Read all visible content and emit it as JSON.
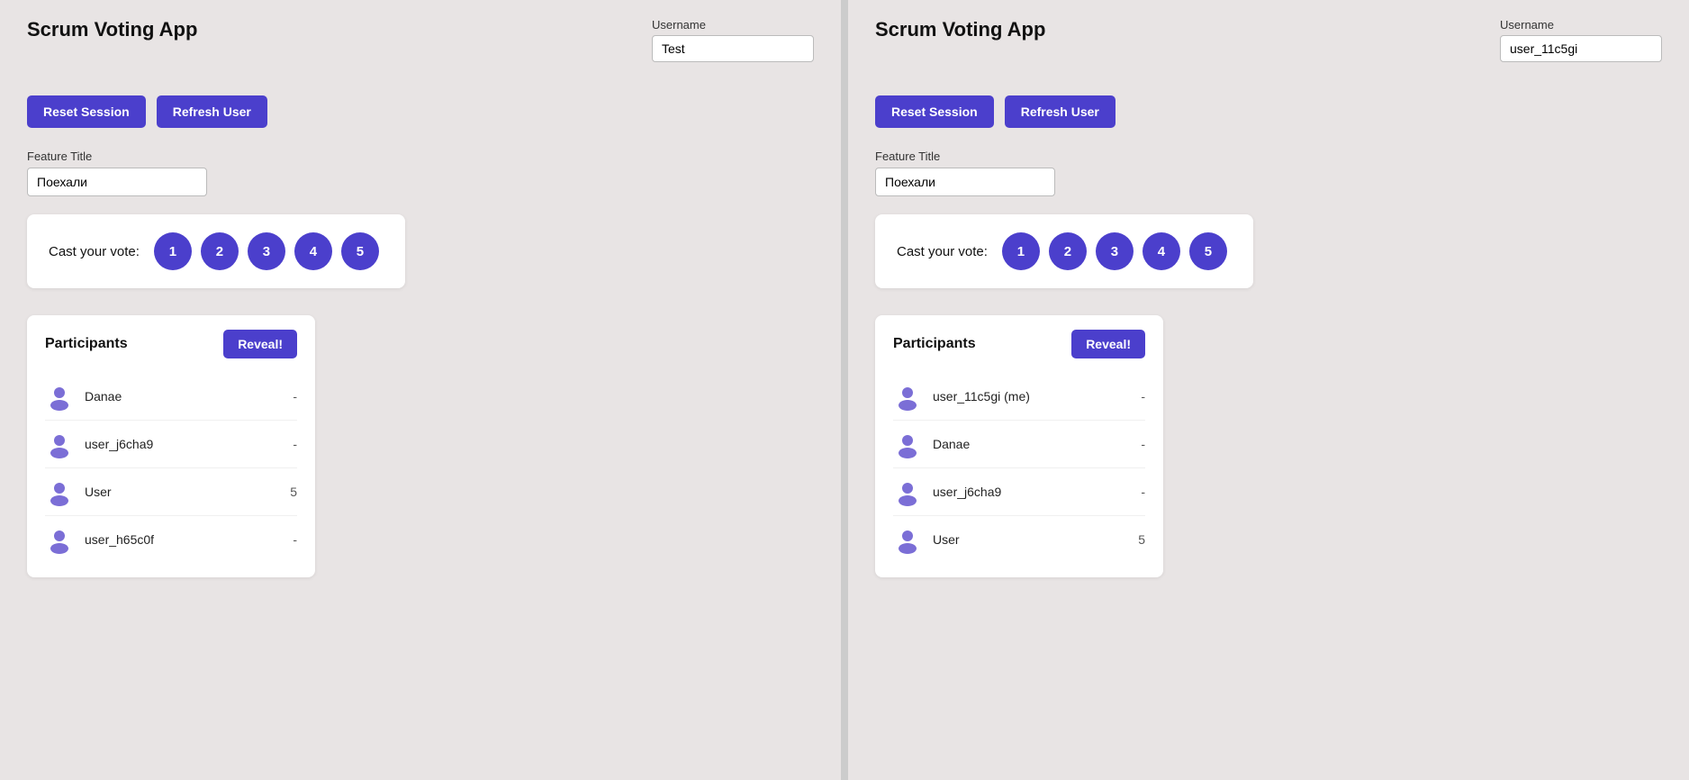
{
  "left_panel": {
    "app_title": "Scrum Voting App",
    "username_label": "Username",
    "username_value": "Test",
    "reset_session_label": "Reset Session",
    "refresh_user_label": "Refresh User",
    "feature_title_label": "Feature Title",
    "feature_title_value": "Поехали",
    "cast_vote_label": "Cast your vote:",
    "vote_options": [
      "1",
      "2",
      "3",
      "4",
      "5"
    ],
    "participants_title": "Participants",
    "reveal_label": "Reveal!",
    "participants": [
      {
        "name": "Danae",
        "score": "-"
      },
      {
        "name": "user_j6cha9",
        "score": "-"
      },
      {
        "name": "User",
        "score": "5"
      },
      {
        "name": "user_h65c0f",
        "score": "-"
      }
    ]
  },
  "right_panel": {
    "app_title": "Scrum Voting App",
    "username_label": "Username",
    "username_value": "user_11c5gi",
    "reset_session_label": "Reset Session",
    "refresh_user_label": "Refresh User",
    "feature_title_label": "Feature Title",
    "feature_title_value": "Поехали",
    "cast_vote_label": "Cast your vote:",
    "vote_options": [
      "1",
      "2",
      "3",
      "4",
      "5"
    ],
    "participants_title": "Participants",
    "reveal_label": "Reveal!",
    "participants": [
      {
        "name": "user_11c5gi (me)",
        "score": "-"
      },
      {
        "name": "Danae",
        "score": "-"
      },
      {
        "name": "user_j6cha9",
        "score": "-"
      },
      {
        "name": "User",
        "score": "5"
      }
    ]
  },
  "icons": {
    "user_avatar": "👤"
  }
}
